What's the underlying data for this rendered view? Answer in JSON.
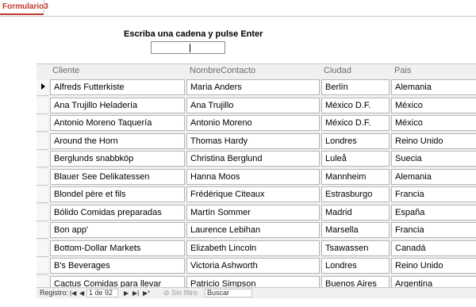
{
  "tab": {
    "label": "Formulario3"
  },
  "prompt": {
    "label": "Escriba una cadena y pulse Enter",
    "value": ""
  },
  "columns": [
    "Cliente",
    "NombreContacto",
    "Ciudad",
    "Pais"
  ],
  "rows": [
    [
      "Alfreds Futterkiste",
      "Maria Anders",
      "Berlín",
      "Alemania"
    ],
    [
      "Ana Trujillo Heladería",
      "Ana Trujillo",
      "México D.F.",
      "México"
    ],
    [
      "Antonio Moreno Taquería",
      "Antonio Moreno",
      "México D.F.",
      "México"
    ],
    [
      "Around the Horn",
      "Thomas Hardy",
      "Londres",
      "Reino Unido"
    ],
    [
      "Berglunds snabbköp",
      "Christina Berglund",
      "Luleå",
      "Suecia"
    ],
    [
      "Blauer See Delikatessen",
      "Hanna Moos",
      "Mannheim",
      "Alemania"
    ],
    [
      "Blondel père et fils",
      "Frédérique Citeaux",
      "Estrasburgo",
      "Francia"
    ],
    [
      "Bólido Comidas preparadas",
      "Martín Sommer",
      "Madrid",
      "España"
    ],
    [
      "Bon app'",
      "Laurence Lebihan",
      "Marsella",
      "Francia"
    ],
    [
      "Bottom-Dollar Markets",
      "Elizabeth Lincoln",
      "Tsawassen",
      "Canadá"
    ],
    [
      "B's Beverages",
      "Victoria Ashworth",
      "Londres",
      "Reino Unido"
    ],
    [
      "Cactus Comidas para llevar",
      "Patricio Simpson",
      "Buenos Aires",
      "Argentina"
    ]
  ],
  "nav": {
    "record_label": "Registro:",
    "first_icon": "first-record-icon",
    "prev_icon": "previous-record-icon",
    "pager": "1 de 92",
    "next_icon": "next-record-icon",
    "last_icon": "last-record-icon",
    "new_icon": "new-record-icon",
    "filter_label": "Sin filtro",
    "search_label": "Buscar"
  }
}
